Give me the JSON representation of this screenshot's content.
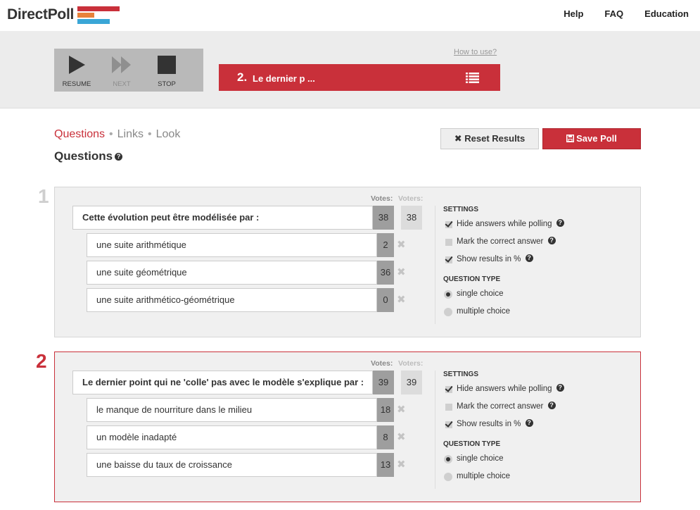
{
  "brand": {
    "name": "DirectPoll",
    "bar_colors": [
      "#c9303a",
      "#e8823a",
      "#3aa6d6"
    ]
  },
  "nav": {
    "links": [
      "Help",
      "FAQ",
      "Education"
    ]
  },
  "controls": {
    "resume_label": "RESUME",
    "next_label": "NEXT",
    "stop_label": "STOP",
    "how_to_use": "How to use?",
    "current_number": "2.",
    "current_text": "Le dernier p ..."
  },
  "tabs": {
    "questions": "Questions",
    "links": "Links",
    "look": "Look",
    "separator": "•"
  },
  "section_title": "Questions",
  "buttons": {
    "reset": "✖ Reset Results",
    "save": "Save Poll"
  },
  "labels": {
    "votes": "Votes:",
    "voters": "Voters:",
    "settings": "SETTINGS",
    "hide_answers": "Hide answers while polling",
    "mark_correct": "Mark the correct answer",
    "show_percent": "Show results in %",
    "question_type": "QUESTION TYPE",
    "single_choice": "single choice",
    "multiple_choice": "multiple choice"
  },
  "questions": [
    {
      "number": "1",
      "text": "Cette évolution peut être modélisée par :",
      "votes": "38",
      "voters": "38",
      "answers": [
        {
          "text": "une suite arithmétique",
          "votes": "2"
        },
        {
          "text": "une suite géométrique",
          "votes": "36"
        },
        {
          "text": "une suite arithmético-géométrique",
          "votes": "0"
        }
      ],
      "settings": {
        "hide_answers": true,
        "mark_correct": false,
        "show_percent": true,
        "type": "single"
      }
    },
    {
      "number": "2",
      "text": "Le dernier point qui ne 'colle' pas avec le modèle s'explique par :",
      "votes": "39",
      "voters": "39",
      "answers": [
        {
          "text": "le manque de nourriture dans le milieu",
          "votes": "18"
        },
        {
          "text": "un modèle inadapté",
          "votes": "8"
        },
        {
          "text": "une baisse du taux de croissance",
          "votes": "13"
        }
      ],
      "settings": {
        "hide_answers": true,
        "mark_correct": false,
        "show_percent": true,
        "type": "single"
      }
    }
  ],
  "colors": {
    "accent": "#c9303a",
    "inactive_num": "#cfcfcf"
  }
}
